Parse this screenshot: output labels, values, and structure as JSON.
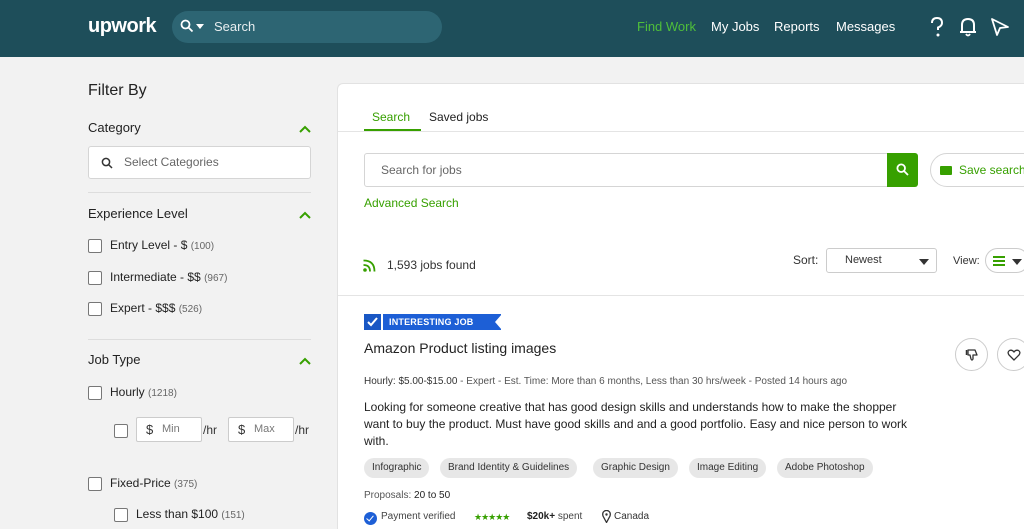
{
  "header": {
    "logo": "upwork",
    "search_placeholder": "Search",
    "nav": [
      "Find Work",
      "My Jobs",
      "Reports",
      "Messages"
    ],
    "active_color": "#4fbf3a",
    "bg_color": "#1e4e5a"
  },
  "sidebar": {
    "title": "Filter By",
    "category": {
      "title": "Category",
      "placeholder": "Select Categories"
    },
    "experience": {
      "title": "Experience Level",
      "items": [
        {
          "label": "Entry Level - $",
          "count": "(100)"
        },
        {
          "label": "Intermediate - $$",
          "count": "(967)"
        },
        {
          "label": "Expert - $$$",
          "count": "(526)"
        }
      ]
    },
    "job_type": {
      "title": "Job Type",
      "hourly": {
        "label": "Hourly",
        "count": "(1218)"
      },
      "rate": {
        "currency": "$",
        "min": "Min",
        "max": "Max",
        "unit": "/hr"
      },
      "fixed": {
        "label": "Fixed-Price",
        "count": "(375)"
      },
      "fixed_sub": {
        "label": "Less than $100",
        "count": "(151)"
      }
    }
  },
  "main": {
    "tabs": [
      "Search",
      "Saved jobs"
    ],
    "search_placeholder": "Search for jobs",
    "save_search": "Save search",
    "advanced": "Advanced Search",
    "jobs_count": "1,593",
    "jobs_suffix": " jobs found",
    "sort_label": "Sort:",
    "sort_value": "Newest",
    "view_label": "View:",
    "accent_color": "#37a000"
  },
  "job": {
    "ribbon": "INTERESTING JOB",
    "title": "Amazon Product listing images",
    "meta_rate": "Hourly: $5.00-$15.00",
    "meta_rest": " - Expert - Est. Time: More than 6 months, Less than 30 hrs/week - Posted 14 hours ago",
    "description": "Looking for someone creative that has good design skills and understands how to make the shopper want to buy the product. Must have good skills and and a good portfolio. Easy and nice person to work with.",
    "skills": [
      "Infographic",
      "Brand Identity & Guidelines",
      "Graphic Design",
      "Image Editing",
      "Adobe Photoshop"
    ],
    "proposals_label": "Proposals: ",
    "proposals_value": "20 to 50",
    "payment": "Payment verified",
    "stars": "★★★★★",
    "spent_value": "$20k+",
    "spent_label": " spent",
    "country": "Canada"
  }
}
